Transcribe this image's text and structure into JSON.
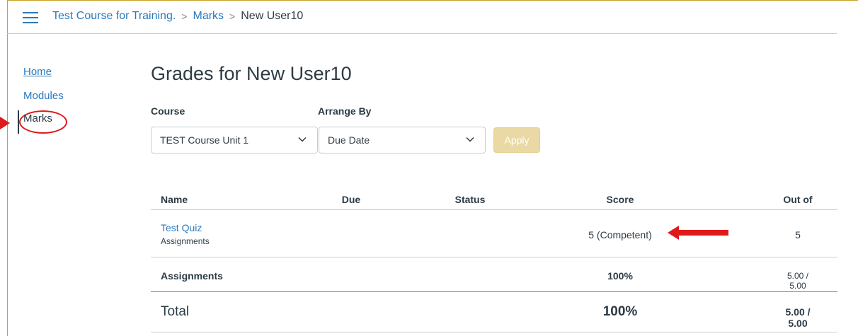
{
  "breadcrumb": {
    "course": "Test Course for Training.",
    "section": "Marks",
    "current": "New User10",
    "separator": ">"
  },
  "nav": {
    "items": [
      {
        "label": "Home"
      },
      {
        "label": "Modules"
      },
      {
        "label": "Marks"
      }
    ],
    "active": "Marks"
  },
  "page": {
    "title": "Grades for New User10"
  },
  "filters": {
    "course_label": "Course",
    "course_value": "TEST Course Unit 1",
    "arrange_label": "Arrange By",
    "arrange_value": "Due Date",
    "apply_label": "Apply"
  },
  "table": {
    "headers": {
      "name": "Name",
      "due": "Due",
      "status": "Status",
      "score": "Score",
      "out_of": "Out of"
    },
    "rows": [
      {
        "name": "Test Quiz",
        "group": "Assignments",
        "due": "",
        "status": "",
        "score": "5 (Competent)",
        "out_of": "5"
      }
    ],
    "group_totals": [
      {
        "name": "Assignments",
        "score": "100%",
        "out_of": "5.00 / 5.00"
      }
    ],
    "total": {
      "name": "Total",
      "score": "100%",
      "out_of": "5.00 / 5.00"
    }
  },
  "icons": {
    "menu": "hamburger-icon",
    "dropdown": "chevron-down-icon"
  },
  "colors": {
    "link": "#2b7abc",
    "text": "#2d3b45",
    "apply_bg": "#ead9a5",
    "annotation": "#e0191b",
    "frame": "#c9a227"
  }
}
